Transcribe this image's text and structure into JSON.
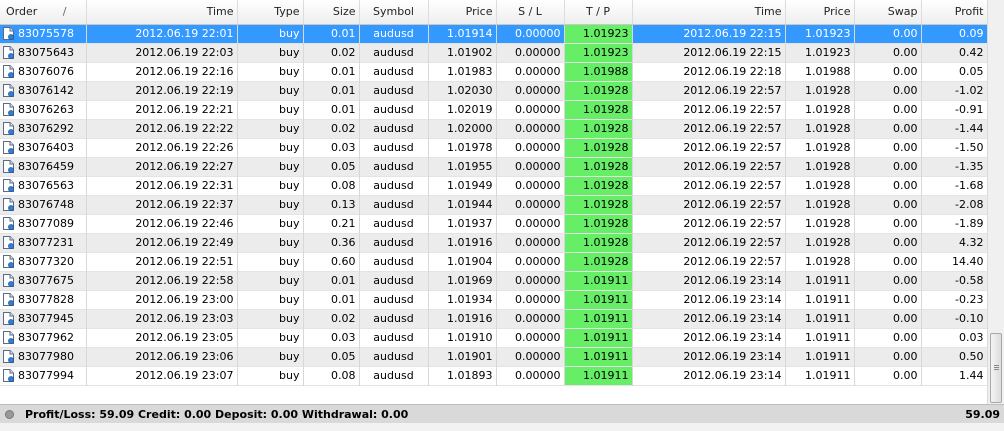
{
  "columns": {
    "order": "Order",
    "sort_marker": "/",
    "open_time": "Time",
    "type": "Type",
    "size": "Size",
    "symbol": "Symbol",
    "open_price": "Price",
    "sl": "S / L",
    "tp": "T / P",
    "close_time": "Time",
    "close_price": "Price",
    "swap": "Swap",
    "profit": "Profit"
  },
  "rows": [
    {
      "order": "83075578",
      "open_time": "2012.06.19 22:01",
      "type": "buy",
      "size": "0.01",
      "symbol": "audusd",
      "open_price": "1.01914",
      "sl": "0.00000",
      "tp": "1.01923",
      "close_time": "2012.06.19 22:15",
      "close_price": "1.01923",
      "swap": "0.00",
      "profit": "0.09",
      "selected": true
    },
    {
      "order": "83075643",
      "open_time": "2012.06.19 22:03",
      "type": "buy",
      "size": "0.02",
      "symbol": "audusd",
      "open_price": "1.01902",
      "sl": "0.00000",
      "tp": "1.01923",
      "close_time": "2012.06.19 22:15",
      "close_price": "1.01923",
      "swap": "0.00",
      "profit": "0.42"
    },
    {
      "order": "83076076",
      "open_time": "2012.06.19 22:16",
      "type": "buy",
      "size": "0.01",
      "symbol": "audusd",
      "open_price": "1.01983",
      "sl": "0.00000",
      "tp": "1.01988",
      "close_time": "2012.06.19 22:18",
      "close_price": "1.01988",
      "swap": "0.00",
      "profit": "0.05"
    },
    {
      "order": "83076142",
      "open_time": "2012.06.19 22:19",
      "type": "buy",
      "size": "0.01",
      "symbol": "audusd",
      "open_price": "1.02030",
      "sl": "0.00000",
      "tp": "1.01928",
      "close_time": "2012.06.19 22:57",
      "close_price": "1.01928",
      "swap": "0.00",
      "profit": "-1.02"
    },
    {
      "order": "83076263",
      "open_time": "2012.06.19 22:21",
      "type": "buy",
      "size": "0.01",
      "symbol": "audusd",
      "open_price": "1.02019",
      "sl": "0.00000",
      "tp": "1.01928",
      "close_time": "2012.06.19 22:57",
      "close_price": "1.01928",
      "swap": "0.00",
      "profit": "-0.91"
    },
    {
      "order": "83076292",
      "open_time": "2012.06.19 22:22",
      "type": "buy",
      "size": "0.02",
      "symbol": "audusd",
      "open_price": "1.02000",
      "sl": "0.00000",
      "tp": "1.01928",
      "close_time": "2012.06.19 22:57",
      "close_price": "1.01928",
      "swap": "0.00",
      "profit": "-1.44"
    },
    {
      "order": "83076403",
      "open_time": "2012.06.19 22:26",
      "type": "buy",
      "size": "0.03",
      "symbol": "audusd",
      "open_price": "1.01978",
      "sl": "0.00000",
      "tp": "1.01928",
      "close_time": "2012.06.19 22:57",
      "close_price": "1.01928",
      "swap": "0.00",
      "profit": "-1.50"
    },
    {
      "order": "83076459",
      "open_time": "2012.06.19 22:27",
      "type": "buy",
      "size": "0.05",
      "symbol": "audusd",
      "open_price": "1.01955",
      "sl": "0.00000",
      "tp": "1.01928",
      "close_time": "2012.06.19 22:57",
      "close_price": "1.01928",
      "swap": "0.00",
      "profit": "-1.35"
    },
    {
      "order": "83076563",
      "open_time": "2012.06.19 22:31",
      "type": "buy",
      "size": "0.08",
      "symbol": "audusd",
      "open_price": "1.01949",
      "sl": "0.00000",
      "tp": "1.01928",
      "close_time": "2012.06.19 22:57",
      "close_price": "1.01928",
      "swap": "0.00",
      "profit": "-1.68"
    },
    {
      "order": "83076748",
      "open_time": "2012.06.19 22:37",
      "type": "buy",
      "size": "0.13",
      "symbol": "audusd",
      "open_price": "1.01944",
      "sl": "0.00000",
      "tp": "1.01928",
      "close_time": "2012.06.19 22:57",
      "close_price": "1.01928",
      "swap": "0.00",
      "profit": "-2.08"
    },
    {
      "order": "83077089",
      "open_time": "2012.06.19 22:46",
      "type": "buy",
      "size": "0.21",
      "symbol": "audusd",
      "open_price": "1.01937",
      "sl": "0.00000",
      "tp": "1.01928",
      "close_time": "2012.06.19 22:57",
      "close_price": "1.01928",
      "swap": "0.00",
      "profit": "-1.89"
    },
    {
      "order": "83077231",
      "open_time": "2012.06.19 22:49",
      "type": "buy",
      "size": "0.36",
      "symbol": "audusd",
      "open_price": "1.01916",
      "sl": "0.00000",
      "tp": "1.01928",
      "close_time": "2012.06.19 22:57",
      "close_price": "1.01928",
      "swap": "0.00",
      "profit": "4.32"
    },
    {
      "order": "83077320",
      "open_time": "2012.06.19 22:51",
      "type": "buy",
      "size": "0.60",
      "symbol": "audusd",
      "open_price": "1.01904",
      "sl": "0.00000",
      "tp": "1.01928",
      "close_time": "2012.06.19 22:57",
      "close_price": "1.01928",
      "swap": "0.00",
      "profit": "14.40"
    },
    {
      "order": "83077675",
      "open_time": "2012.06.19 22:58",
      "type": "buy",
      "size": "0.01",
      "symbol": "audusd",
      "open_price": "1.01969",
      "sl": "0.00000",
      "tp": "1.01911",
      "close_time": "2012.06.19 23:14",
      "close_price": "1.01911",
      "swap": "0.00",
      "profit": "-0.58"
    },
    {
      "order": "83077828",
      "open_time": "2012.06.19 23:00",
      "type": "buy",
      "size": "0.01",
      "symbol": "audusd",
      "open_price": "1.01934",
      "sl": "0.00000",
      "tp": "1.01911",
      "close_time": "2012.06.19 23:14",
      "close_price": "1.01911",
      "swap": "0.00",
      "profit": "-0.23"
    },
    {
      "order": "83077945",
      "open_time": "2012.06.19 23:03",
      "type": "buy",
      "size": "0.02",
      "symbol": "audusd",
      "open_price": "1.01916",
      "sl": "0.00000",
      "tp": "1.01911",
      "close_time": "2012.06.19 23:14",
      "close_price": "1.01911",
      "swap": "0.00",
      "profit": "-0.10"
    },
    {
      "order": "83077962",
      "open_time": "2012.06.19 23:05",
      "type": "buy",
      "size": "0.03",
      "symbol": "audusd",
      "open_price": "1.01910",
      "sl": "0.00000",
      "tp": "1.01911",
      "close_time": "2012.06.19 23:14",
      "close_price": "1.01911",
      "swap": "0.00",
      "profit": "0.03"
    },
    {
      "order": "83077980",
      "open_time": "2012.06.19 23:06",
      "type": "buy",
      "size": "0.05",
      "symbol": "audusd",
      "open_price": "1.01901",
      "sl": "0.00000",
      "tp": "1.01911",
      "close_time": "2012.06.19 23:14",
      "close_price": "1.01911",
      "swap": "0.00",
      "profit": "0.50"
    },
    {
      "order": "83077994",
      "open_time": "2012.06.19 23:07",
      "type": "buy",
      "size": "0.08",
      "symbol": "audusd",
      "open_price": "1.01893",
      "sl": "0.00000",
      "tp": "1.01911",
      "close_time": "2012.06.19 23:14",
      "close_price": "1.01911",
      "swap": "0.00",
      "profit": "1.44"
    }
  ],
  "status": {
    "summary": "Profit/Loss: 59.09  Credit: 0.00  Deposit: 0.00  Withdrawal: 0.00",
    "total": "59.09"
  },
  "colors": {
    "selection": "#3399ff",
    "tp_highlight": "#66ee66"
  },
  "icons": {
    "row": "order-document-icon",
    "status": "status-circle-icon"
  }
}
